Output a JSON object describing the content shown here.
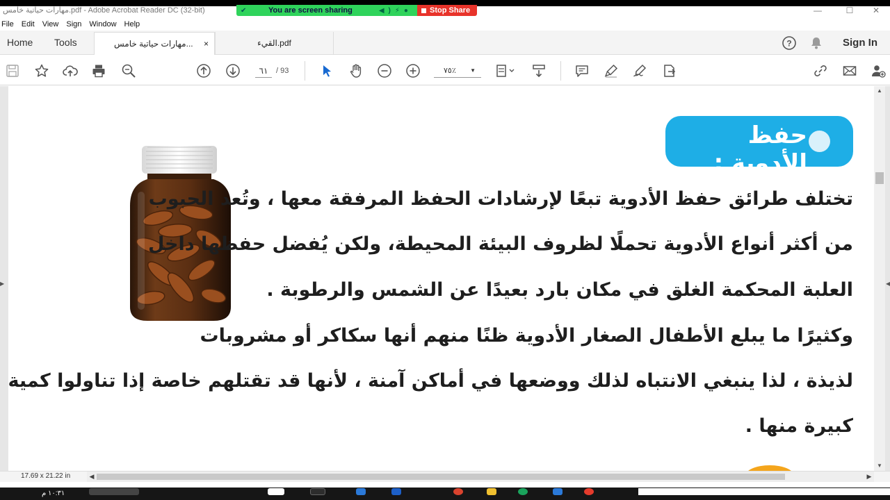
{
  "window": {
    "title": "مهارات حياتية خامس.pdf - Adobe Acrobat Reader DC (32-bit)",
    "minimize": "—",
    "maximize": "☐",
    "close": "✕"
  },
  "share_banner": {
    "message": "You are screen sharing",
    "stop_label": "Stop Share",
    "colors": {
      "sharing": "#2fd35b",
      "stop": "#e8332a"
    }
  },
  "menu": [
    "File",
    "Edit",
    "View",
    "Sign",
    "Window",
    "Help"
  ],
  "tabs": {
    "home": "Home",
    "tools": "Tools",
    "documents": [
      {
        "label": "مهارات حياتية خامس...",
        "active": true,
        "close": "×"
      },
      {
        "label": "القيء.pdf",
        "active": false
      }
    ],
    "help_icon": "question-circle-icon",
    "bell_icon": "bell-icon",
    "sign_in": "Sign In"
  },
  "toolbar": {
    "left_tools": [
      "save-icon",
      "bookmark-star-icon",
      "upload-cloud-icon",
      "print-icon",
      "search-zoom-icon"
    ],
    "page_current": "٦١",
    "page_total": "/ 93",
    "zoom_value": "٧٥٪",
    "right_tools": [
      "comment-icon",
      "highlight-pen-icon",
      "sign-icon",
      "share-doc-icon",
      "link-icon",
      "email-icon",
      "add-user-icon"
    ]
  },
  "document": {
    "heading": "حفظ الأدوية :",
    "lines": [
      "تختلف طرائق حفظ الأدوية تبعًا لإرشادات الحفظ المرفقة معها ، وتُعد الحبوب",
      "من أكثر أنواع الأدوية تحملًا لظروف البيئة المحيطة، ولكن يُفضل حفظها داخل",
      "العلبة المحكمة الغلق في مكان بارد بعيدًا عن الشمس والرطوبة .",
      "وكثيرًا ما يبلع الأطفال الصغار الأدوية ظنًا منهم أنها سكاكر أو مشروبات",
      "لذيذة ، لذا ينبغي الانتباه لذلك ووضعها في أماكن آمنة ، لأنها قد تقتلهم خاصة إذا تناولوا كمية",
      "كبيرة منها ."
    ],
    "colors": {
      "heading_bg": "#1eaee6",
      "text": "#1e1e1e"
    }
  },
  "status": {
    "page_size": "17.69 x 21.22 in"
  },
  "taskbar": {
    "time": "١٠:٣١ م"
  }
}
